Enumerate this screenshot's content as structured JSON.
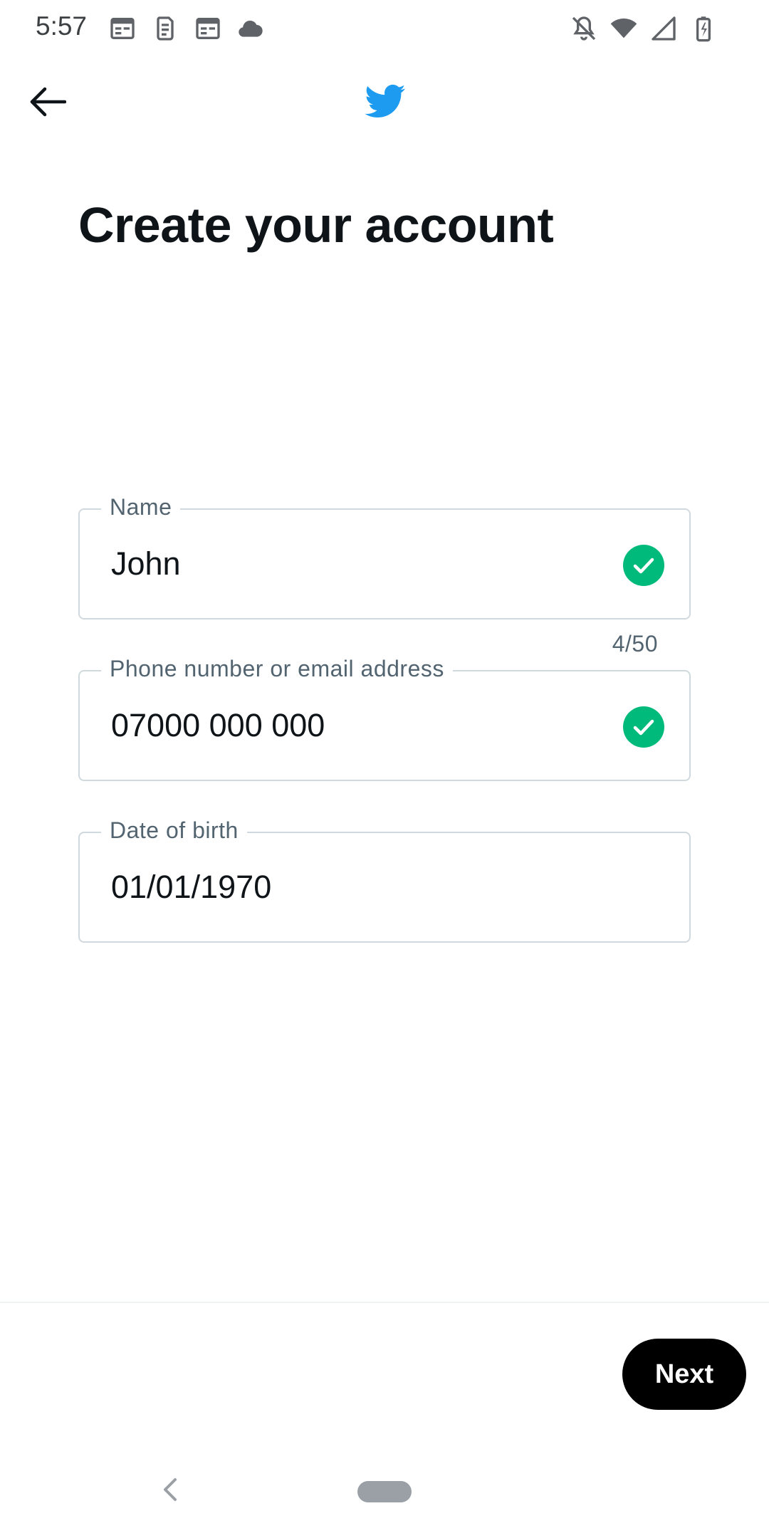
{
  "status_bar": {
    "time": "5:57",
    "left_icons": [
      "calendar-icon",
      "sim-card-icon",
      "calendar-icon",
      "cloud-icon"
    ],
    "right_icons": [
      "notifications-off-icon",
      "wifi-icon",
      "cell-signal-icon",
      "battery-charging-icon"
    ]
  },
  "header": {
    "back_icon": "arrow-left-icon",
    "logo_icon": "twitter-bird-icon",
    "brand_color": "#1d9bf0"
  },
  "title": "Create your account",
  "form": {
    "name": {
      "label": "Name",
      "value": "John",
      "valid": true,
      "counter": "4/50"
    },
    "contact": {
      "label": "Phone number or email address",
      "value": "07000 000 000",
      "valid": true
    },
    "dob": {
      "label": "Date of birth",
      "value": "01/01/1970"
    },
    "valid_color": "#00ba7c"
  },
  "footer": {
    "next_label": "Next"
  },
  "system_nav": {
    "back_icon": "chevron-left-icon",
    "home_icon": "home-pill-icon"
  }
}
